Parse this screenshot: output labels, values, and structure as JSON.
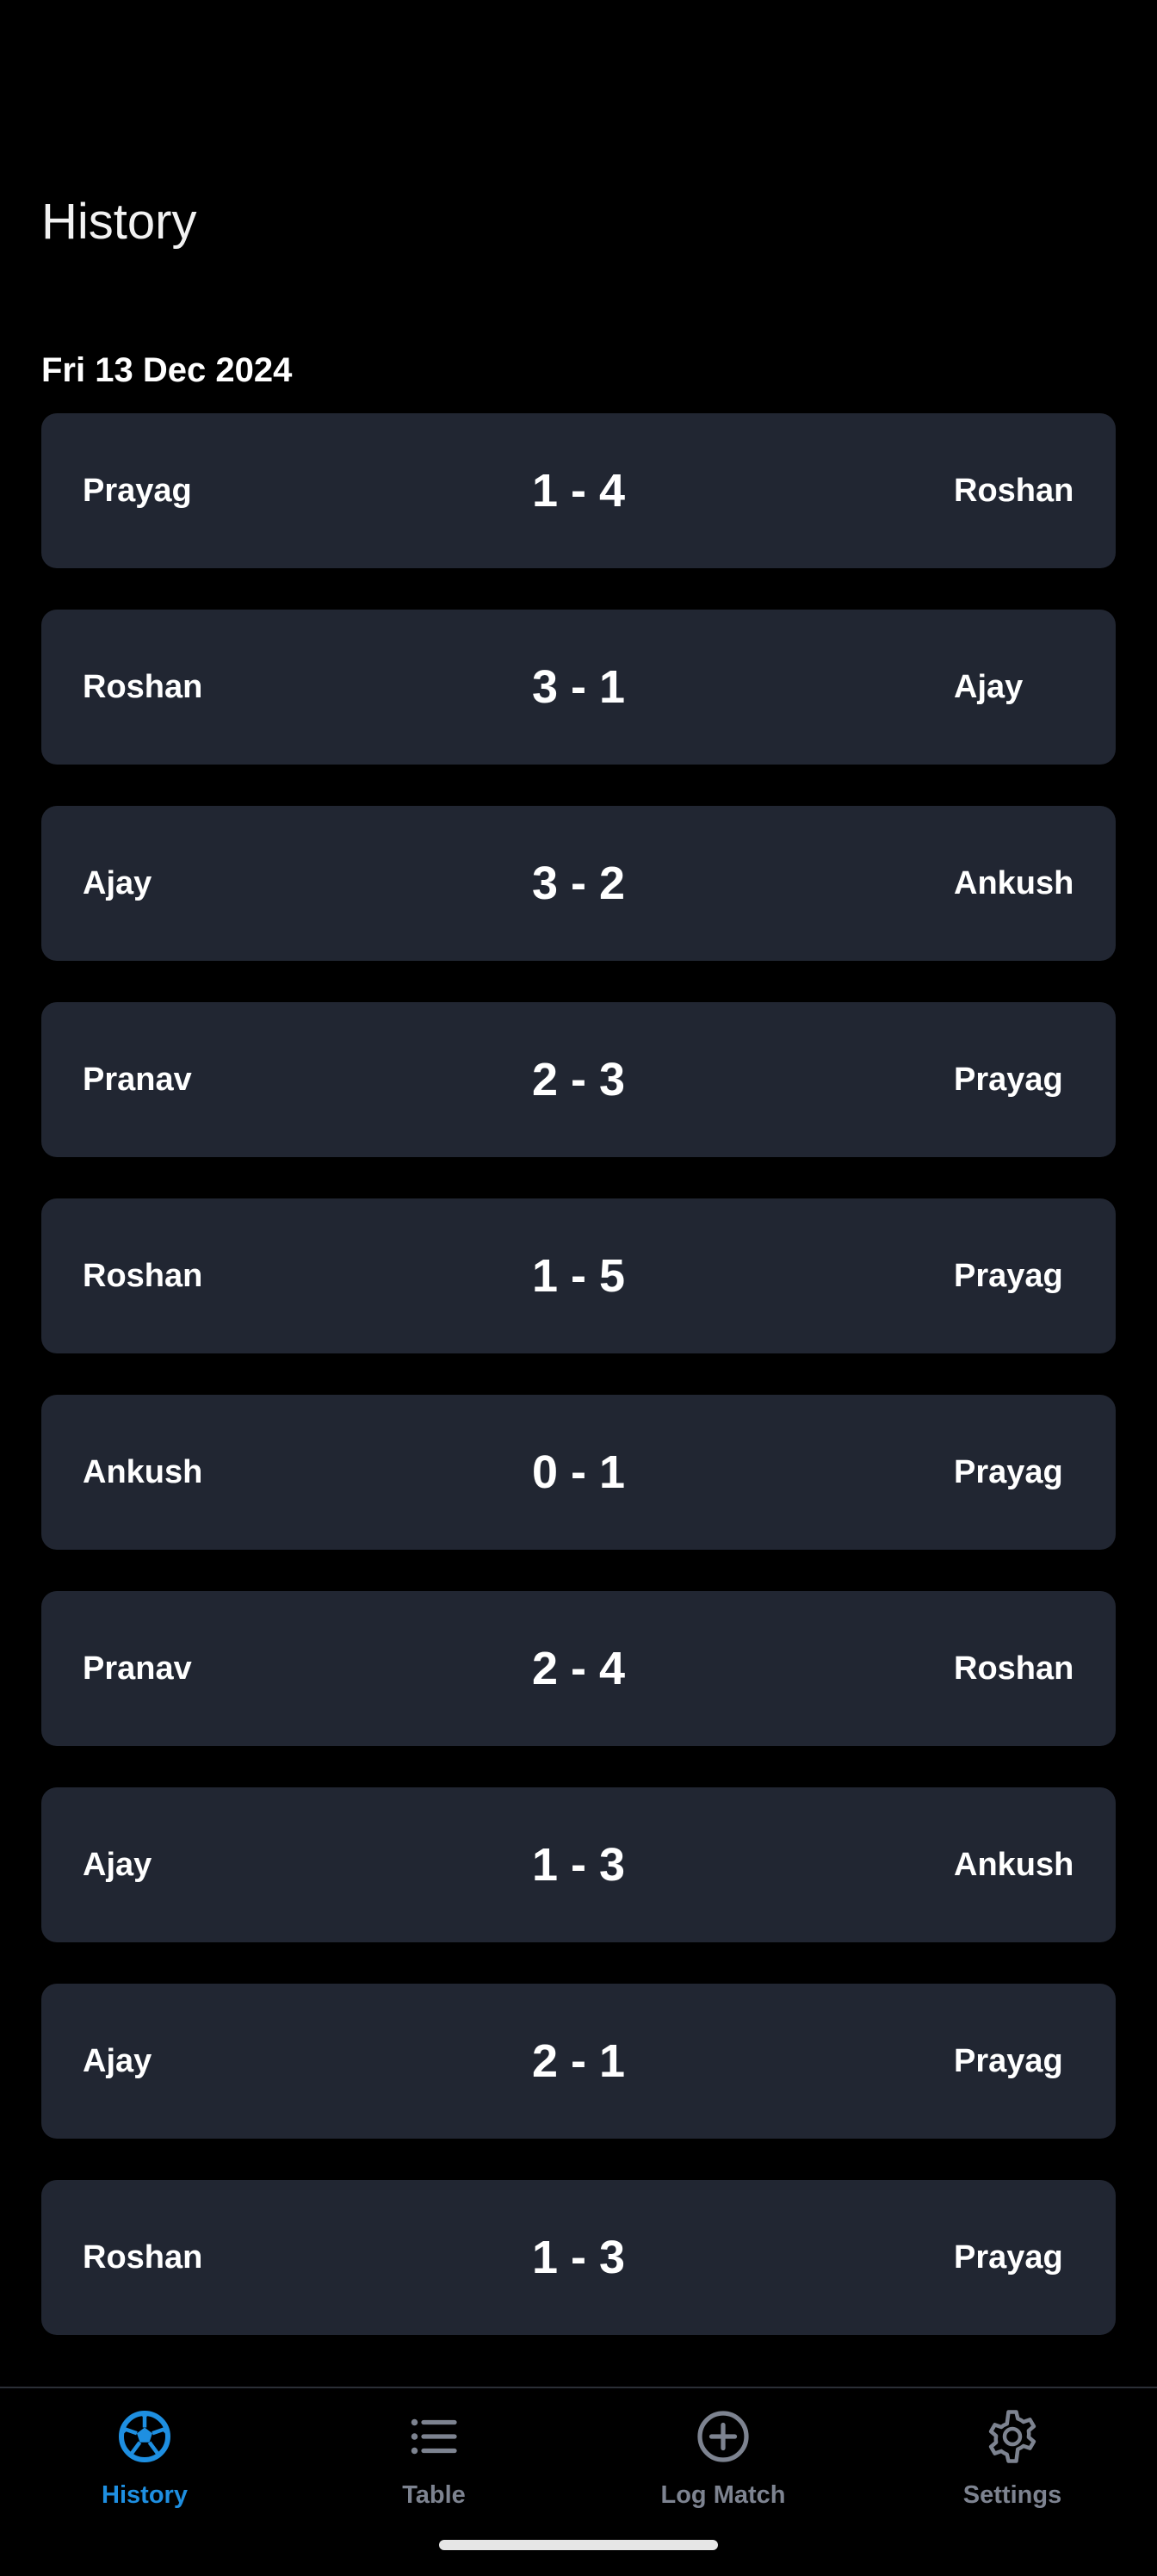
{
  "page": {
    "title": "History"
  },
  "history": {
    "groups": [
      {
        "date": "Fri 13 Dec 2024",
        "matches": [
          {
            "left": "Prayag",
            "score": "1 - 4",
            "right": "Roshan"
          },
          {
            "left": "Roshan",
            "score": "3 - 1",
            "right": "Ajay"
          },
          {
            "left": "Ajay",
            "score": "3 - 2",
            "right": "Ankush"
          },
          {
            "left": "Pranav",
            "score": "2 - 3",
            "right": "Prayag"
          },
          {
            "left": "Roshan",
            "score": "1 - 5",
            "right": "Prayag"
          },
          {
            "left": "Ankush",
            "score": "0 - 1",
            "right": "Prayag"
          },
          {
            "left": "Pranav",
            "score": "2 - 4",
            "right": "Roshan"
          },
          {
            "left": "Ajay",
            "score": "1 - 3",
            "right": "Ankush"
          },
          {
            "left": "Ajay",
            "score": "2 - 1",
            "right": "Prayag"
          },
          {
            "left": "Roshan",
            "score": "1 - 3",
            "right": "Prayag"
          }
        ]
      }
    ]
  },
  "nav": {
    "items": [
      {
        "label": "History",
        "icon": "soccer-ball-icon",
        "active": true
      },
      {
        "label": "Table",
        "icon": "list-icon",
        "active": false
      },
      {
        "label": "Log Match",
        "icon": "add-circle-icon",
        "active": false
      },
      {
        "label": "Settings",
        "icon": "gear-icon",
        "active": false
      }
    ]
  },
  "colors": {
    "background": "#000000",
    "card": "#212632",
    "accent": "#1e8fe1",
    "inactive": "#7d8390"
  }
}
